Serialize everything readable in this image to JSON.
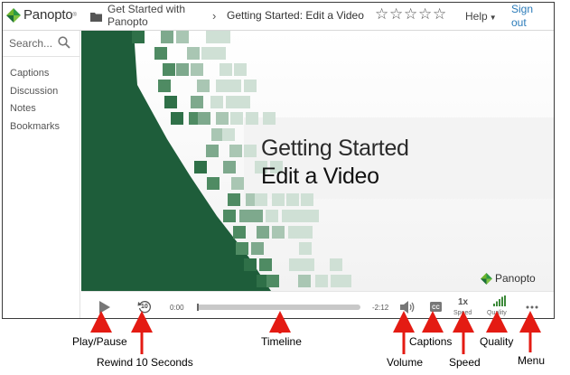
{
  "header": {
    "logo_text": "Panopto",
    "logo_reg": "®",
    "folder_title": "Get Started with Panopto",
    "breadcrumb_chevron": "›",
    "session_title": "Getting Started: Edit a Video",
    "star_glyph": "☆",
    "help_label": "Help",
    "sign_out_label": "Sign out"
  },
  "sidebar": {
    "search_placeholder": "Search...",
    "items": [
      {
        "label": "Captions"
      },
      {
        "label": "Discussion"
      },
      {
        "label": "Notes"
      },
      {
        "label": "Bookmarks"
      }
    ]
  },
  "slide": {
    "title_line1": "Getting Started",
    "title_line2": "Edit a Video",
    "logo_text": "Panopto",
    "accent_color": "#2e7d4f"
  },
  "controls": {
    "current_time": "0:00",
    "remaining_time": "-2:12",
    "speed_value": "1x",
    "speed_label": "Speed",
    "quality_label": "Quality",
    "rewind_seconds": "10"
  },
  "annotations": {
    "play_pause": "Play/Pause",
    "rewind": "Rewind 10 Seconds",
    "timeline": "Timeline",
    "volume": "Volume",
    "captions": "Captions",
    "speed": "Speed",
    "quality": "Quality",
    "menu": "Menu",
    "arrow_color": "#e41b13"
  }
}
